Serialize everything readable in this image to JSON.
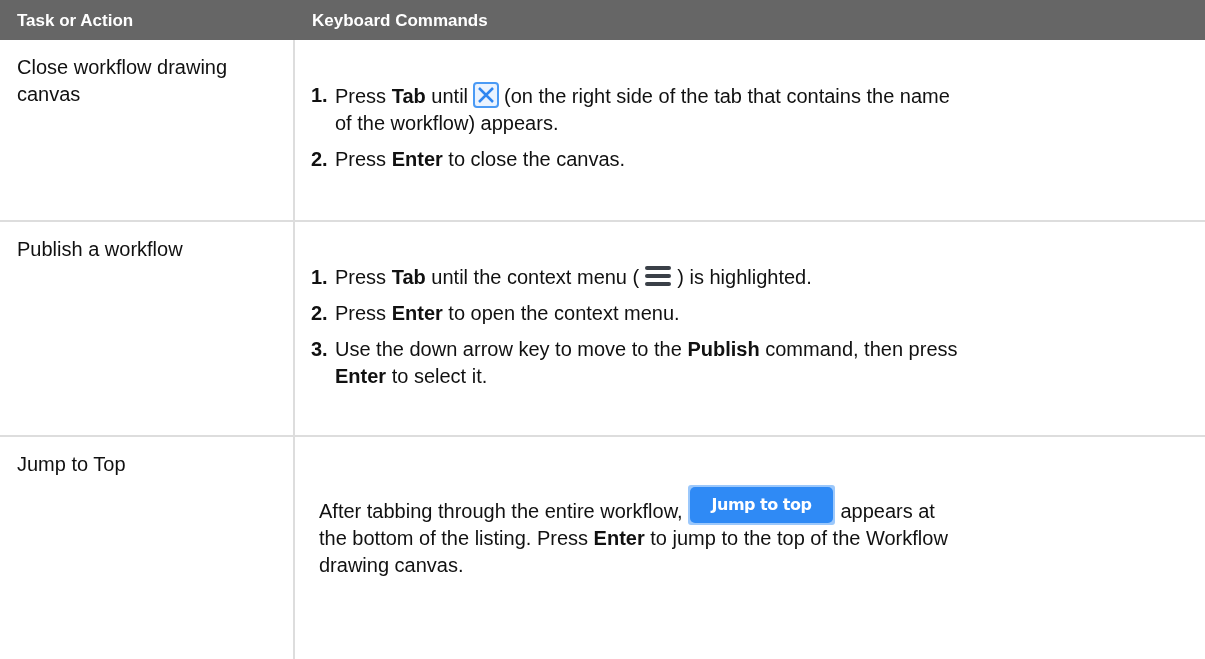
{
  "table": {
    "columns": [
      "Task or Action",
      "Keyboard Commands"
    ],
    "rows": [
      {
        "task": "Close workflow drawing canvas",
        "kind": "steps",
        "steps": [
          {
            "number": "1.",
            "lines": [
              [
                {
                  "kind": "text",
                  "text": "Press **Tab** until"
                },
                {
                  "kind": "close-icon"
                },
                {
                  "kind": "text",
                  "text": "(on the right side of the tab that contains the name"
                }
              ],
              [
                {
                  "kind": "text",
                  "text": "of the workflow) appears."
                }
              ]
            ]
          },
          {
            "number": "2.",
            "lines": [
              [
                {
                  "kind": "text",
                  "text": "Press **Enter** to close the canvas."
                }
              ]
            ]
          }
        ]
      },
      {
        "task": "Publish a workflow",
        "kind": "steps",
        "steps": [
          {
            "number": "1.",
            "lines": [
              [
                {
                  "kind": "text",
                  "text": "Press **Tab** until the context menu ("
                },
                {
                  "kind": "menu-icon"
                },
                {
                  "kind": "text",
                  "text": ") is highlighted."
                }
              ]
            ]
          },
          {
            "number": "2.",
            "lines": [
              [
                {
                  "kind": "text",
                  "text": "Press **Enter** to open the context menu."
                }
              ]
            ]
          },
          {
            "number": "3.",
            "lines": [
              [
                {
                  "kind": "text",
                  "text": "Use the down arrow key to move to the **Publish** command, then press"
                }
              ],
              [
                {
                  "kind": "text",
                  "text": "**Enter** to select it."
                }
              ]
            ]
          }
        ]
      },
      {
        "task": "Jump to Top",
        "kind": "paragraph",
        "lines": [
          [
            {
              "kind": "text",
              "text": "After tabbing through the entire workflow,"
            },
            {
              "kind": "button",
              "text": "Jump to top"
            },
            {
              "kind": "text",
              "text": "appears at"
            }
          ],
          [
            {
              "kind": "text",
              "text": "the bottom of the listing. Press **Enter** to jump to the top of the Workflow"
            }
          ],
          [
            {
              "kind": "text",
              "text": "drawing canvas."
            }
          ]
        ]
      }
    ]
  }
}
